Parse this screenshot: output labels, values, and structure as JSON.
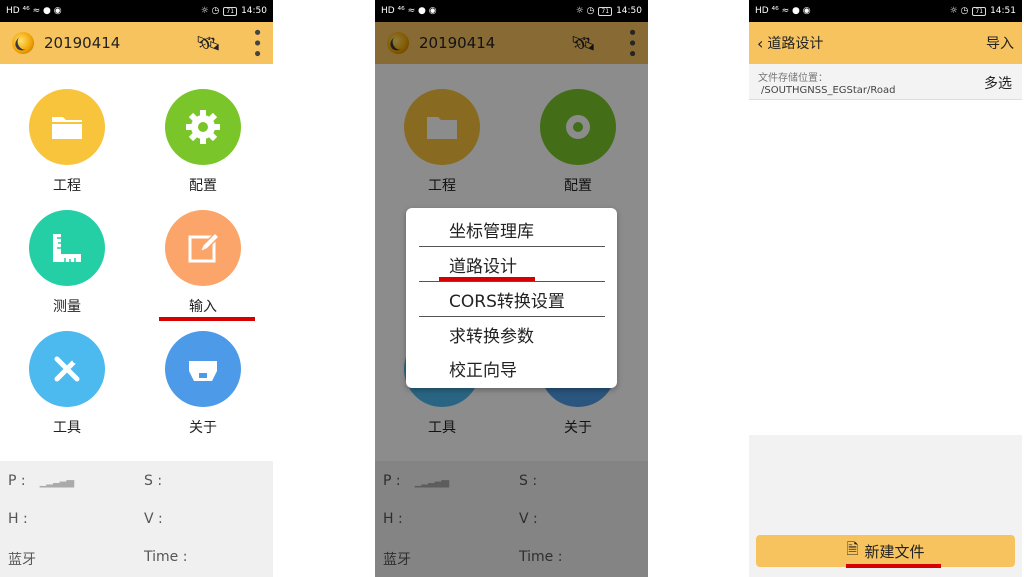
{
  "status": {
    "left_icons": "HD ⁴⁶ ≈ ● ◉",
    "right_icons": "☼ ◷",
    "battery": "71"
  },
  "panel1": {
    "time": "14:50",
    "app_title": "20190414",
    "grid": [
      "工程",
      "配置",
      "测量",
      "输入",
      "工具",
      "关于"
    ],
    "info": {
      "p": "P :",
      "s": "S :",
      "h": "H :",
      "v": "V :",
      "bt": "蓝牙",
      "time": "Time :"
    },
    "signal": "▁▂▃▄▅"
  },
  "panel2": {
    "time": "14:50",
    "app_title": "20190414",
    "menu": [
      "坐标管理库",
      "道路设计",
      "CORS转换设置",
      "求转换参数",
      "校正向导"
    ]
  },
  "panel3": {
    "time": "14:51",
    "title": "道路设计",
    "import": "导入",
    "storage_label": "文件存储位置：",
    "storage_path": "/SOUTHGNSS_EGStar/Road",
    "multi_select": "多选",
    "new_file": "新建文件"
  },
  "colors": {
    "appbar": "#f7c35f",
    "highlight": "#d60000"
  }
}
